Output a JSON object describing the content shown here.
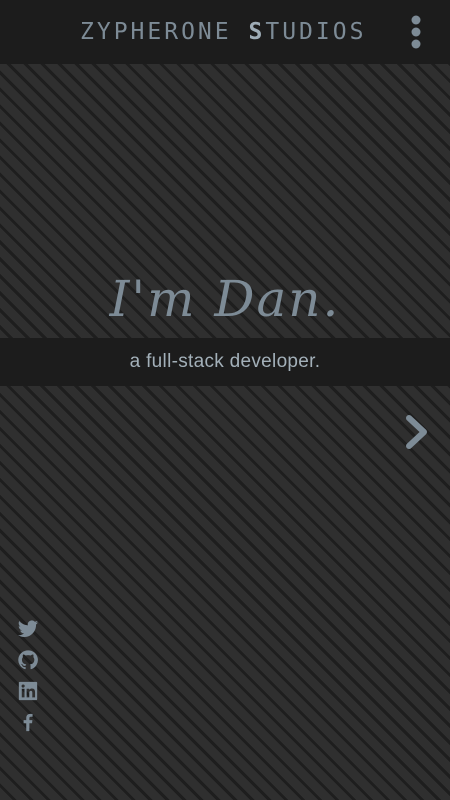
{
  "header": {
    "brand_prefix": "ZYPHERONE ",
    "brand_highlight": "S",
    "brand_suffix": "TUDIOS",
    "menu_icon": "kebab-vertical-icon"
  },
  "hero": {
    "name": "I'm Dan.",
    "tagline": "a full-stack developer.",
    "next_icon": "chevron-right-icon"
  },
  "social": [
    {
      "name": "twitter",
      "icon": "twitter-icon"
    },
    {
      "name": "github",
      "icon": "github-icon"
    },
    {
      "name": "linkedin",
      "icon": "linkedin-icon"
    },
    {
      "name": "facebook",
      "icon": "facebook-icon"
    }
  ],
  "colors": {
    "background": "#2c2c2c",
    "bar": "#1c1c1c",
    "accent": "#7d8b96",
    "text": "#a3b0b9"
  }
}
